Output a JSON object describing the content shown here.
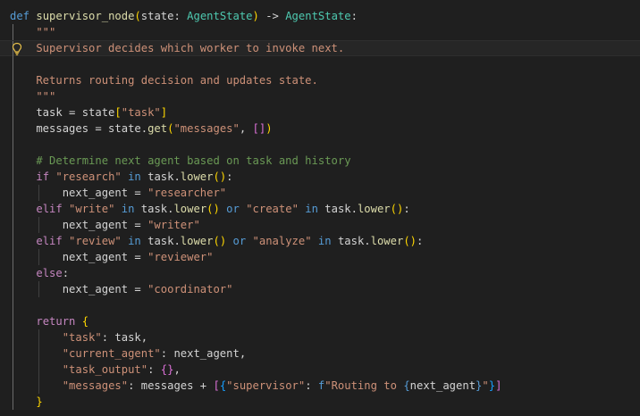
{
  "editor": {
    "language": "python",
    "theme_colors": {
      "background": "#1f1f1f",
      "keyword_def": "#569cd6",
      "function": "#dcdcaa",
      "type": "#4ec9b0",
      "string": "#ce9178",
      "control_keyword": "#c586c0",
      "comment": "#6a9955",
      "bracket_level1": "#ffd700",
      "bracket_level2": "#da70d6",
      "bracket_level3": "#179fff",
      "gutter_lightbulb": "#e8c04a"
    },
    "gutter_icon": "lightbulb-icon",
    "gutter_icon_line": 2,
    "current_line": 2,
    "lines": [
      [
        [
          "t-kw-def",
          "def "
        ],
        [
          "t-fn",
          "supervisor_node"
        ],
        [
          "t-b1",
          "("
        ],
        [
          "t-var",
          "state"
        ],
        [
          "t-plain",
          ": "
        ],
        [
          "t-type",
          "AgentState"
        ],
        [
          "t-b1",
          ")"
        ],
        [
          "t-plain",
          " -> "
        ],
        [
          "t-type",
          "AgentState"
        ],
        [
          "t-plain",
          ":"
        ]
      ],
      [
        [
          "t-str",
          "    \"\"\""
        ]
      ],
      [
        [
          "t-str",
          "    Supervisor decides which worker to invoke next."
        ]
      ],
      [],
      [
        [
          "t-str",
          "    Returns routing decision and updates state."
        ]
      ],
      [
        [
          "t-str",
          "    \"\"\""
        ]
      ],
      [
        [
          "t-plain",
          "    task = state"
        ],
        [
          "t-b1",
          "["
        ],
        [
          "t-str",
          "\"task\""
        ],
        [
          "t-b1",
          "]"
        ]
      ],
      [
        [
          "t-plain",
          "    messages = state."
        ],
        [
          "t-fn",
          "get"
        ],
        [
          "t-b1",
          "("
        ],
        [
          "t-str",
          "\"messages\""
        ],
        [
          "t-plain",
          ", "
        ],
        [
          "t-b2",
          "[]"
        ],
        [
          "t-b1",
          ")"
        ]
      ],
      [],
      [
        [
          "t-comment",
          "    # Determine next agent based on task and history"
        ]
      ],
      [
        [
          "t-plain",
          "    "
        ],
        [
          "t-kw",
          "if "
        ],
        [
          "t-str",
          "\"research\""
        ],
        [
          "t-kw-blue",
          " in "
        ],
        [
          "t-plain",
          "task."
        ],
        [
          "t-fn",
          "lower"
        ],
        [
          "t-b1",
          "()"
        ],
        [
          "t-plain",
          ":"
        ]
      ],
      [
        [
          "t-plain",
          "        next_agent = "
        ],
        [
          "t-str",
          "\"researcher\""
        ]
      ],
      [
        [
          "t-plain",
          "    "
        ],
        [
          "t-kw",
          "elif "
        ],
        [
          "t-str",
          "\"write\""
        ],
        [
          "t-kw-blue",
          " in "
        ],
        [
          "t-plain",
          "task."
        ],
        [
          "t-fn",
          "lower"
        ],
        [
          "t-b1",
          "()"
        ],
        [
          "t-kw-blue",
          " or "
        ],
        [
          "t-str",
          "\"create\""
        ],
        [
          "t-kw-blue",
          " in "
        ],
        [
          "t-plain",
          "task."
        ],
        [
          "t-fn",
          "lower"
        ],
        [
          "t-b1",
          "()"
        ],
        [
          "t-plain",
          ":"
        ]
      ],
      [
        [
          "t-plain",
          "        next_agent = "
        ],
        [
          "t-str",
          "\"writer\""
        ]
      ],
      [
        [
          "t-plain",
          "    "
        ],
        [
          "t-kw",
          "elif "
        ],
        [
          "t-str",
          "\"review\""
        ],
        [
          "t-kw-blue",
          " in "
        ],
        [
          "t-plain",
          "task."
        ],
        [
          "t-fn",
          "lower"
        ],
        [
          "t-b1",
          "()"
        ],
        [
          "t-kw-blue",
          " or "
        ],
        [
          "t-str",
          "\"analyze\""
        ],
        [
          "t-kw-blue",
          " in "
        ],
        [
          "t-plain",
          "task."
        ],
        [
          "t-fn",
          "lower"
        ],
        [
          "t-b1",
          "()"
        ],
        [
          "t-plain",
          ":"
        ]
      ],
      [
        [
          "t-plain",
          "        next_agent = "
        ],
        [
          "t-str",
          "\"reviewer\""
        ]
      ],
      [
        [
          "t-plain",
          "    "
        ],
        [
          "t-kw",
          "else"
        ],
        [
          "t-plain",
          ":"
        ]
      ],
      [
        [
          "t-plain",
          "        next_agent = "
        ],
        [
          "t-str",
          "\"coordinator\""
        ]
      ],
      [],
      [
        [
          "t-plain",
          "    "
        ],
        [
          "t-kw",
          "return "
        ],
        [
          "t-b1",
          "{"
        ]
      ],
      [
        [
          "t-plain",
          "        "
        ],
        [
          "t-str",
          "\"task\""
        ],
        [
          "t-plain",
          ": task,"
        ]
      ],
      [
        [
          "t-plain",
          "        "
        ],
        [
          "t-str",
          "\"current_agent\""
        ],
        [
          "t-plain",
          ": next_agent,"
        ]
      ],
      [
        [
          "t-plain",
          "        "
        ],
        [
          "t-str",
          "\"task_output\""
        ],
        [
          "t-plain",
          ": "
        ],
        [
          "t-b2",
          "{}"
        ],
        [
          "t-plain",
          ","
        ]
      ],
      [
        [
          "t-plain",
          "        "
        ],
        [
          "t-str",
          "\"messages\""
        ],
        [
          "t-plain",
          ": messages + "
        ],
        [
          "t-b2",
          "["
        ],
        [
          "t-b3",
          "{"
        ],
        [
          "t-str",
          "\"supervisor\""
        ],
        [
          "t-plain",
          ": "
        ],
        [
          "t-kw-blue",
          "f"
        ],
        [
          "t-str",
          "\"Routing to "
        ],
        [
          "t-kw-blue",
          "{"
        ],
        [
          "t-plain",
          "next_agent"
        ],
        [
          "t-kw-blue",
          "}"
        ],
        [
          "t-str",
          "\""
        ],
        [
          "t-b3",
          "}"
        ],
        [
          "t-b2",
          "]"
        ]
      ],
      [
        [
          "t-plain",
          "    "
        ],
        [
          "t-b1",
          "}"
        ]
      ]
    ],
    "indent_guides": [
      {
        "line": 1,
        "levels": [
          1
        ]
      },
      {
        "line": 2,
        "levels": [
          1
        ]
      },
      {
        "line": 3,
        "levels": [
          1
        ]
      },
      {
        "line": 4,
        "levels": [
          1
        ]
      },
      {
        "line": 5,
        "levels": [
          1
        ]
      },
      {
        "line": 6,
        "levels": [
          1
        ]
      },
      {
        "line": 7,
        "levels": [
          1
        ]
      },
      {
        "line": 8,
        "levels": [
          1
        ]
      },
      {
        "line": 9,
        "levels": [
          1
        ]
      },
      {
        "line": 10,
        "levels": [
          1
        ]
      },
      {
        "line": 11,
        "levels": [
          1,
          2
        ]
      },
      {
        "line": 12,
        "levels": [
          1
        ]
      },
      {
        "line": 13,
        "levels": [
          1,
          2
        ]
      },
      {
        "line": 14,
        "levels": [
          1
        ]
      },
      {
        "line": 15,
        "levels": [
          1,
          2
        ]
      },
      {
        "line": 16,
        "levels": [
          1
        ]
      },
      {
        "line": 17,
        "levels": [
          1,
          2
        ]
      },
      {
        "line": 18,
        "levels": [
          1
        ]
      },
      {
        "line": 19,
        "levels": [
          1
        ]
      },
      {
        "line": 20,
        "levels": [
          1,
          2
        ]
      },
      {
        "line": 21,
        "levels": [
          1,
          2
        ]
      },
      {
        "line": 22,
        "levels": [
          1,
          2
        ]
      },
      {
        "line": 23,
        "levels": [
          1,
          2
        ]
      },
      {
        "line": 24,
        "levels": [
          1
        ]
      }
    ]
  }
}
